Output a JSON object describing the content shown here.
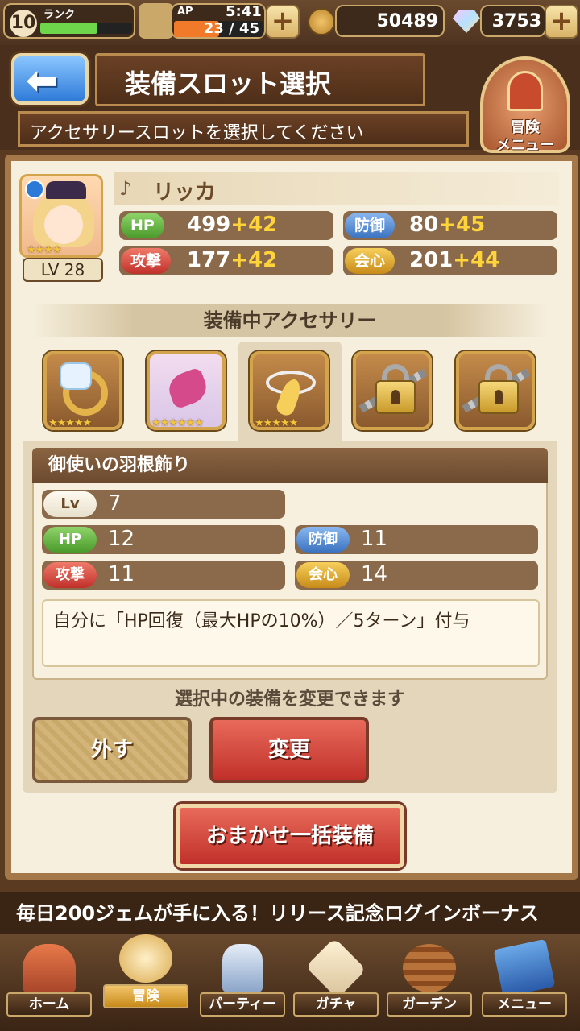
{
  "status": {
    "rank_level": "10",
    "rank_label": "ランク",
    "rank_progress": 0.62,
    "ap_label": "AP",
    "ap_time": "5:41",
    "ap_value": "23 / 45",
    "ap_progress": 0.51,
    "coins": "50489",
    "gems": "3753"
  },
  "header": {
    "title": "装備スロット選択",
    "subtitle": "アクセサリースロットを選択してください",
    "adventure_menu": [
      "冒険",
      "メニュー"
    ]
  },
  "character": {
    "name": "リッカ",
    "level": "LV 28",
    "stars": "★★★★",
    "stats": [
      {
        "label": "HP",
        "base": "499",
        "bonus": "+42",
        "color": "#5aa83a"
      },
      {
        "label": "防御",
        "base": "80",
        "bonus": "+45",
        "color": "#3a72c0"
      },
      {
        "label": "攻撃",
        "base": "177",
        "bonus": "+42",
        "color": "#c0302a"
      },
      {
        "label": "会心",
        "base": "201",
        "bonus": "+44",
        "color": "#c88b1a"
      }
    ]
  },
  "equipped_section": {
    "heading": "装備中アクセサリー",
    "slots": [
      {
        "icon": "diamond-ring-icon",
        "stars": "★★★★★"
      },
      {
        "icon": "feather-ornament-icon",
        "stars": "★★★★★★"
      },
      {
        "icon": "angel-feather-icon",
        "stars": "★★★★★",
        "selected": true
      },
      {
        "icon": "lock-icon",
        "stars": ""
      },
      {
        "icon": "lock-icon",
        "stars": ""
      }
    ]
  },
  "detail": {
    "item_name": "御使いの羽根飾り",
    "lv_label": "Lv",
    "lv": "7",
    "stats": [
      {
        "label": "HP",
        "value": "12"
      },
      {
        "label": "防御",
        "value": "11"
      },
      {
        "label": "攻撃",
        "value": "11"
      },
      {
        "label": "会心",
        "value": "14"
      }
    ],
    "description": "自分に「HP回復（最大HPの10%）／5ターン」付与",
    "change_note": "選択中の装備を変更できます"
  },
  "buttons": {
    "unequip": "外す",
    "change": "変更",
    "auto_equip": "おまかせ一括装備"
  },
  "ticker": "毎日200ジェムが手に入る！リリース記念ログインボーナス",
  "nav": [
    {
      "label": "ホーム",
      "icon": "house-icon"
    },
    {
      "label": "冒険",
      "icon": "compass-map-icon",
      "active": true
    },
    {
      "label": "パーティー",
      "icon": "chess-pieces-icon"
    },
    {
      "label": "ガチャ",
      "icon": "gacha-dice-icon"
    },
    {
      "label": "ガーデン",
      "icon": "basket-icon"
    },
    {
      "label": "メニュー",
      "icon": "book-icon"
    }
  ]
}
